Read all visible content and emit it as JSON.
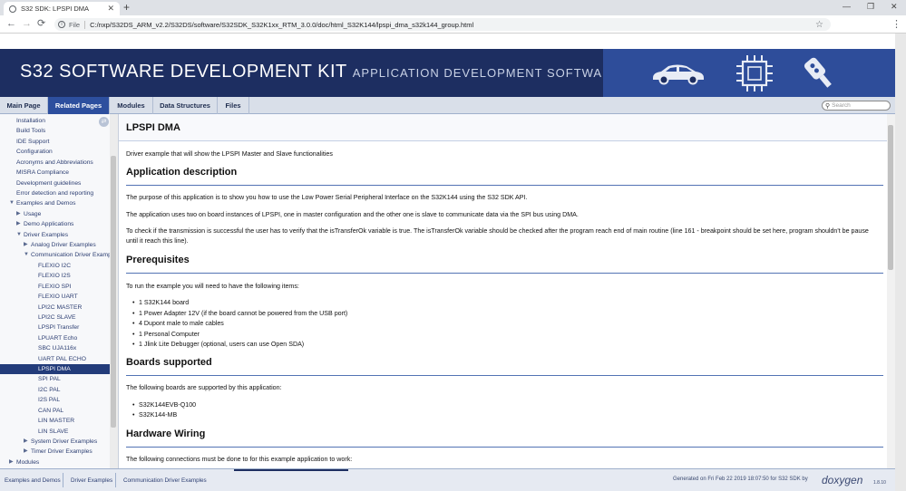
{
  "browser": {
    "tab_title": "S32 SDK: LPSPI DMA",
    "new_tab": "+",
    "win_min": "—",
    "win_max": "❐",
    "win_close": "✕",
    "url_label": "File",
    "url": "C:/nxp/S32DS_ARM_v2.2/S32DS/software/S32SDK_S32K1xx_RTM_3.0.0/doc/html_S32K144/lpspi_dma_s32k144_group.html",
    "icons": [
      "back-icon",
      "forward-icon",
      "reload-icon",
      "info-icon",
      "star-icon",
      "menu-icon"
    ]
  },
  "banner": {
    "title": "S32 SOFTWARE DEVELOPMENT KIT",
    "subtitle": "APPLICATION DEVELOPMENT SOFTWARE",
    "bg_color": "#1d2e61",
    "art_color": "#2e4d9a"
  },
  "nav": {
    "tabs": [
      {
        "label": "Main Page"
      },
      {
        "label": "Related Pages"
      },
      {
        "label": "Modules"
      },
      {
        "label": "Data Structures"
      },
      {
        "label": "Files"
      }
    ],
    "active_tab": "Related Pages",
    "search_placeholder": "Search"
  },
  "sidebar": {
    "items": [
      {
        "label": "Installation"
      },
      {
        "label": "Build Tools"
      },
      {
        "label": "IDE Support"
      },
      {
        "label": "Configuration"
      },
      {
        "label": "Acronyms and Abbreviations"
      },
      {
        "label": "MISRA Compliance"
      },
      {
        "label": "Development guidelines"
      },
      {
        "label": "Error detection and reporting"
      },
      {
        "label": "Examples and Demos"
      },
      {
        "label": "Usage"
      },
      {
        "label": "Demo Applications"
      },
      {
        "label": "Driver Examples"
      },
      {
        "label": "Analog Driver Examples"
      },
      {
        "label": "Communication Driver Examples"
      },
      {
        "label": "FLEXIO I2C"
      },
      {
        "label": "FLEXIO I2S"
      },
      {
        "label": "FLEXIO SPI"
      },
      {
        "label": "FLEXIO UART"
      },
      {
        "label": "LPI2C MASTER"
      },
      {
        "label": "LPI2C SLAVE"
      },
      {
        "label": "LPSPI Transfer"
      },
      {
        "label": "LPUART Echo"
      },
      {
        "label": "SBC UJA116x"
      },
      {
        "label": "UART PAL ECHO"
      },
      {
        "label": "LPSPI DMA"
      },
      {
        "label": "SPI PAL"
      },
      {
        "label": "I2C PAL"
      },
      {
        "label": "I2S PAL"
      },
      {
        "label": "CAN PAL"
      },
      {
        "label": "LIN MASTER"
      },
      {
        "label": "LIN SLAVE"
      },
      {
        "label": "System Driver Examples"
      },
      {
        "label": "Timer Driver Examples"
      },
      {
        "label": "Modules"
      }
    ],
    "selected": "LPSPI DMA",
    "selected_color": "#233c7a"
  },
  "content": {
    "page_title": "LPSPI DMA",
    "intro": "Driver example that will show the LPSPI Master and Slave functionalities",
    "sections": {
      "app_desc": {
        "heading": "Application description",
        "p1": "The purpose of this application is to show you how to use the Low Power Serial Peripheral Interface on the S32K144 using the S32 SDK API.",
        "p2": "The application uses two on board instances of LPSPI, one in master configuration and the other one is slave to communicate data via the SPI bus using DMA.",
        "p3": "To check if the transmission is successful the user has to verify that the isTransferOk variable is true. The isTransferOk variable should be checked after the program reach end of main routine (line 161 - breakpoint should be set here, program shouldn't be pause until it reach this line)."
      },
      "prereq": {
        "heading": "Prerequisites",
        "intro": "To run the example you will need to have the following items:",
        "items": [
          "1 S32K144 board",
          "1 Power Adapter 12V (if the board cannot be powered from the USB port)",
          "4 Dupont male to male cables",
          "1 Personal Computer",
          "1 Jlink Lite Debugger (optional, users can use Open SDA)"
        ]
      },
      "boards": {
        "heading": "Boards supported",
        "intro": "The following boards are supported by this application:",
        "items": [
          "S32K144EVB-Q100",
          "S32K144-MB"
        ]
      },
      "wiring": {
        "heading": "Hardware Wiring",
        "intro": "The following connections must be done to for this example application to work:"
      }
    }
  },
  "footer": {
    "crumbs": [
      "Examples and Demos",
      "Driver Examples",
      "Communication Driver Examples"
    ],
    "generated": "Generated on Fri Feb 22 2019 18:07:50 for S32 SDK by",
    "doxygen": "doxygen",
    "version": "1.8.10"
  }
}
